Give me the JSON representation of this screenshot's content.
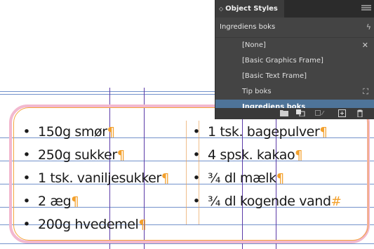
{
  "document": {
    "columns": [
      {
        "items": [
          {
            "text": "150g smør",
            "mark": "¶"
          },
          {
            "text": "250g sukker",
            "mark": "¶"
          },
          {
            "text": "1 tsk. vaniljesukker",
            "mark": "¶"
          },
          {
            "text": "2 æg",
            "mark": "¶"
          },
          {
            "text": "200g hvedemel",
            "mark": "¶"
          }
        ]
      },
      {
        "items": [
          {
            "text": "1 tsk. bagepulver",
            "mark": "¶"
          },
          {
            "text": "4 spsk. kakao",
            "mark": "¶"
          },
          {
            "text": "¾ dl mælk",
            "mark": "¶"
          },
          {
            "text": "¾ dl kogende vand",
            "mark": "#"
          }
        ]
      }
    ],
    "bullet": "•",
    "colors": {
      "frame_border": "#f2b8cf",
      "guide": "#5a7fc2",
      "column_guide": "#5b3aa8",
      "hidden_char": "#f3a02c"
    }
  },
  "panel": {
    "tab_label": "Object Styles",
    "tab_icon": "◇",
    "current_style": "Ingrediens boks",
    "header_icon": "lightning-icon",
    "styles": [
      {
        "label": "[None]",
        "icon": "clear-override-icon",
        "glyph": "✕"
      },
      {
        "label": "[Basic Graphics Frame]"
      },
      {
        "label": "[Basic Text Frame]"
      },
      {
        "label": "Tip boks",
        "icon": "frame-icon",
        "glyph": "⛶"
      },
      {
        "label": "Ingrediens boks",
        "selected": true
      }
    ],
    "footer_icons": [
      "folder-icon",
      "load-styles-icon",
      "clear-overrides-icon",
      "new-style-icon",
      "trash-icon"
    ],
    "selected_color": "#4e7499"
  }
}
